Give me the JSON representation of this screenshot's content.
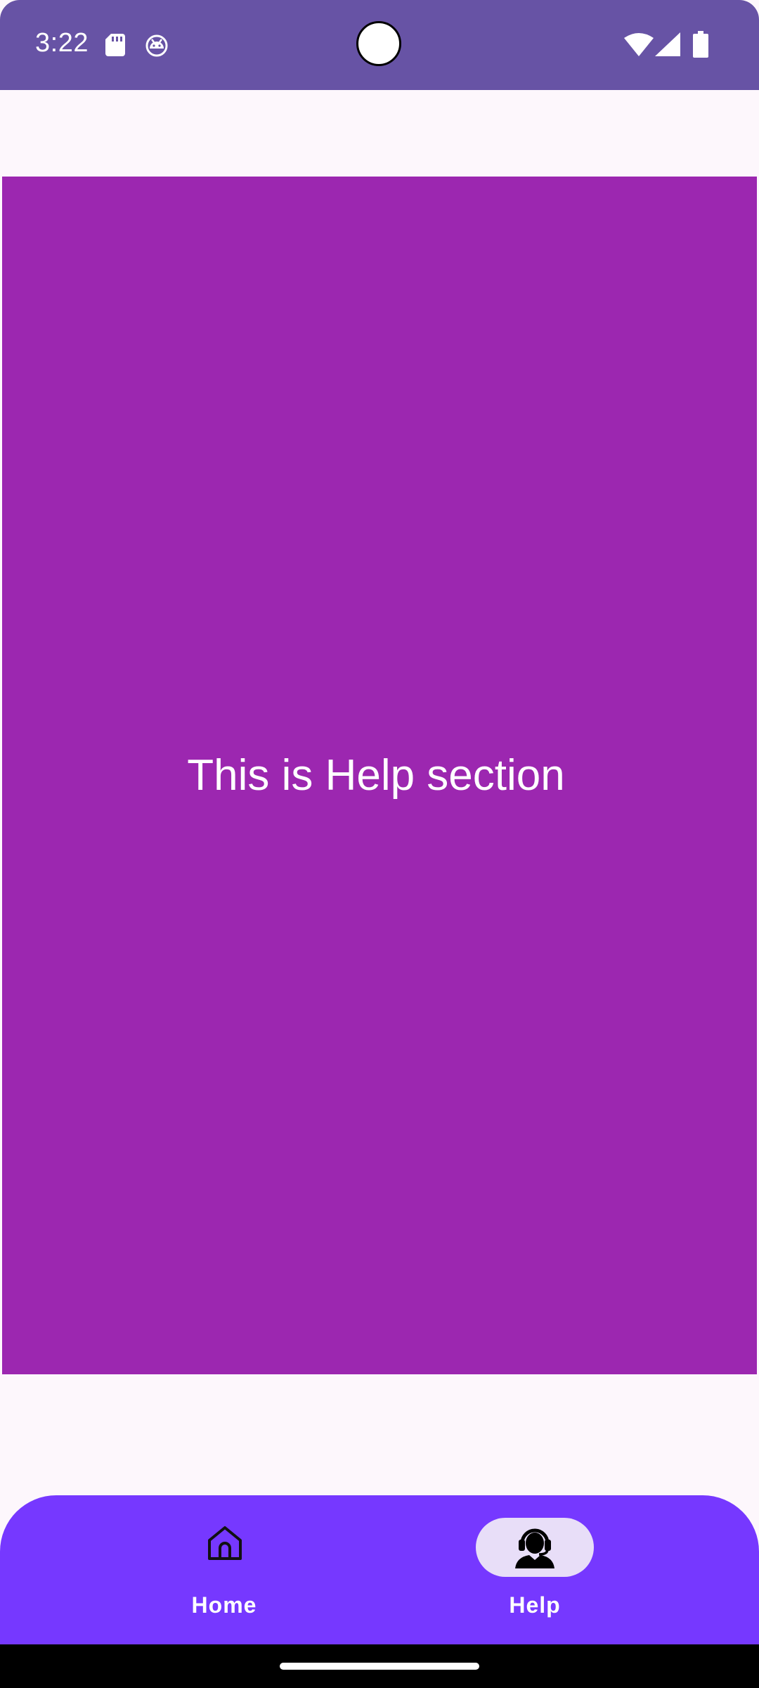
{
  "status_bar": {
    "time": "3:22",
    "background_color": "#6753A5",
    "icons": [
      "sd-card-icon",
      "android-icon",
      "wifi-icon",
      "cell-signal-icon",
      "battery-icon"
    ]
  },
  "content": {
    "message": "This is Help section",
    "panel_color": "#9C27B0"
  },
  "bottom_nav": {
    "background_color": "#7638FF",
    "items": [
      {
        "label": "Home",
        "icon": "home-icon",
        "selected": false
      },
      {
        "label": "Help",
        "icon": "support-agent-icon",
        "selected": true
      }
    ],
    "indicator_color": "#E8DEF8"
  }
}
